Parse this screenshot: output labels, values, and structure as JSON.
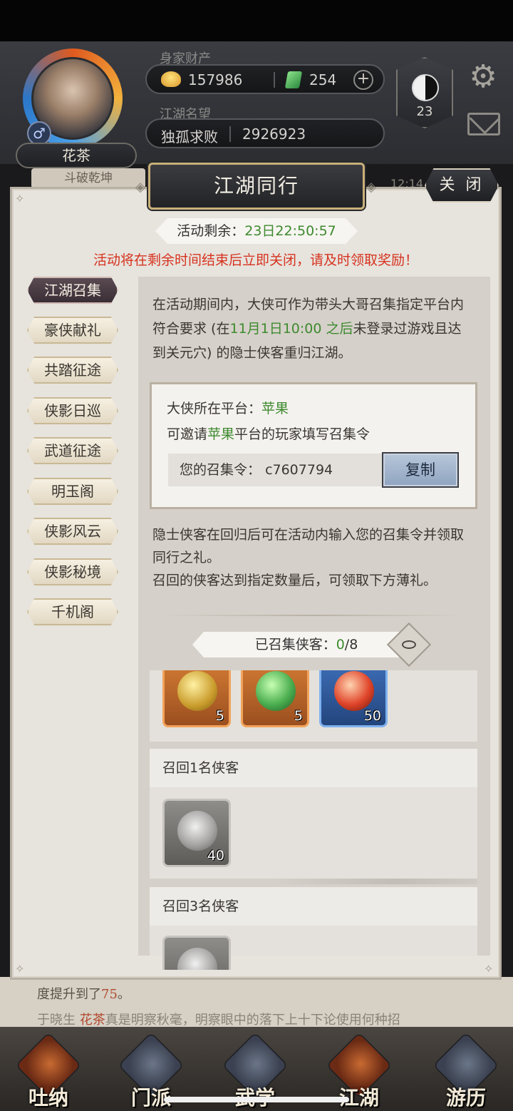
{
  "profile": {
    "name": "花茶",
    "gender_icon": "male-icon"
  },
  "stats": {
    "wealth_label": "身家财产",
    "coins": "157986",
    "jade": "254",
    "fame_label": "江湖名望",
    "fame_title": "独孤求败",
    "fame_value": "2926923"
  },
  "taiji_level": "23",
  "background": {
    "strip_text": "斗破乾坤",
    "time": "12:14",
    "log_line1_prefix": "度提升到了",
    "log_line1_num": "75",
    "log_line1_suffix": "。",
    "log_line2_prefix": "于晓生",
    "log_line2_hl": "花茶",
    "log_line2_suffix": "真是明察秋毫，明察眼中的落下上十下论使用何种招"
  },
  "bottom_nav": [
    {
      "label": "吐纳"
    },
    {
      "label": "门派"
    },
    {
      "label": "武学"
    },
    {
      "label": "江湖"
    },
    {
      "label": "游历"
    }
  ],
  "modal": {
    "title": "江湖同行",
    "close_label": "关 闭",
    "timer_label": "活动剩余：",
    "timer_value": "23日22:50:57",
    "warning": "活动将在剩余时间结束后立即关闭，请及时领取奖励！",
    "tabs": [
      "江湖召集",
      "豪侠献礼",
      "共踏征途",
      "侠影日巡",
      "武道征途",
      "明玉阁",
      "侠影风云",
      "侠影秘境",
      "千机阁"
    ],
    "desc_part1": "在活动期间内，大侠可作为带头大哥召集指定平台内符合要求 (在",
    "desc_highlight": "11月1日10:00 之后",
    "desc_part2": "未登录过游戏且达到关元穴) 的隐士侠客重归江湖。",
    "platform_label": "大侠所在平台：",
    "platform_value": "苹果",
    "invite_prefix": "可邀请",
    "invite_platform": "苹果",
    "invite_suffix": "平台的玩家填写召集令",
    "code_label": "您的召集令：",
    "code_value": "c7607794",
    "copy_label": "复制",
    "desc2_line1": "隐士侠客在回归后可在活动内输入您的召集令并领取同行之礼。",
    "desc2_line2": "召回的侠客达到指定数量后，可领取下方薄礼。",
    "count_label": "已召集侠客：",
    "count_current": "0",
    "count_total": "/8",
    "reward_rows": [
      {
        "title": "",
        "items": [
          {
            "count": "5"
          },
          {
            "count": "5"
          },
          {
            "count": "50"
          }
        ]
      },
      {
        "title": "召回1名侠客",
        "items": [
          {
            "count": "40"
          }
        ]
      },
      {
        "title": "召回3名侠客",
        "items": [
          {
            "count": ""
          }
        ]
      }
    ]
  },
  "colors": {
    "accent_green": "#3e8a2f",
    "warning_red": "#d6331f"
  }
}
